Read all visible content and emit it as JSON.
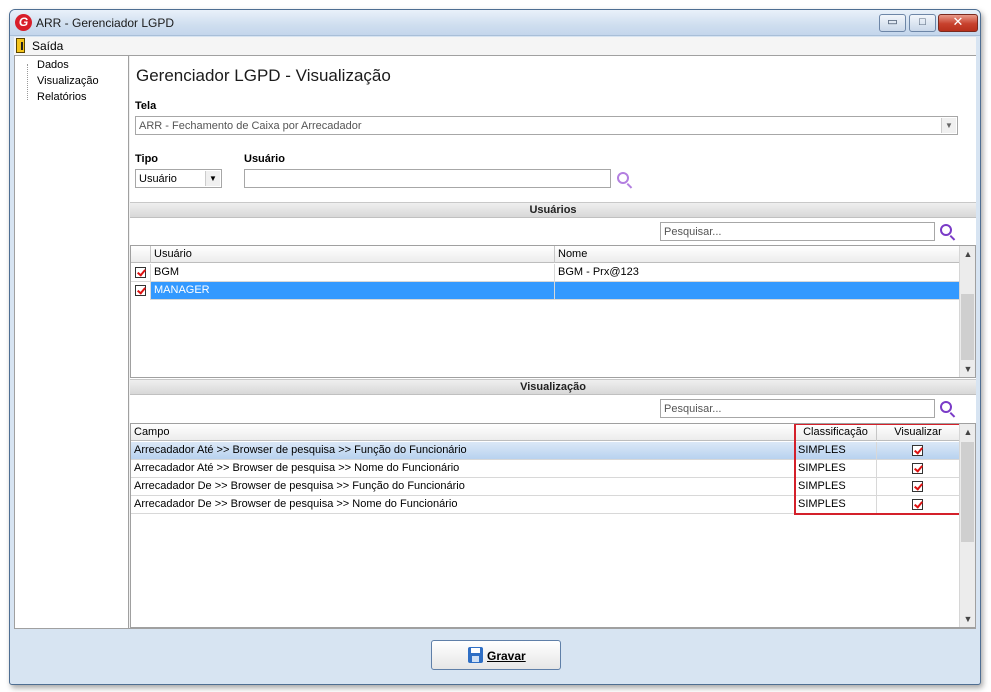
{
  "window": {
    "title": "ARR - Gerenciador LGPD",
    "app_icon_letter": "G",
    "controls": {
      "minimize": "▭",
      "maximize": "□",
      "close": "✕"
    }
  },
  "menu": {
    "exit_label": "Saída"
  },
  "tree": {
    "items": [
      "Dados",
      "Visualização",
      "Relatórios"
    ]
  },
  "page": {
    "title": "Gerenciador LGPD - Visualização",
    "tela_label": "Tela",
    "tela_value": "ARR - Fechamento de Caixa por Arrecadador",
    "tipo_label": "Tipo",
    "tipo_value": "Usuário",
    "usuario_label": "Usuário",
    "usuario_value": ""
  },
  "usuarios": {
    "section_title": "Usuários",
    "search_placeholder": "Pesquisar...",
    "columns": [
      "Usuário",
      "Nome"
    ],
    "rows": [
      {
        "checked": true,
        "usuario": "BGM",
        "nome": "BGM - Prx@123",
        "selected": false
      },
      {
        "checked": true,
        "usuario": "MANAGER",
        "nome": "",
        "selected": true
      }
    ]
  },
  "visualizacao": {
    "section_title": "Visualização",
    "search_placeholder": "Pesquisar...",
    "columns": [
      "Campo",
      "Classificação",
      "Visualizar"
    ],
    "rows": [
      {
        "campo": "Arrecadador Até >> Browser de pesquisa >> Função do Funcionário",
        "classificacao": "SIMPLES",
        "visualizar": true
      },
      {
        "campo": "Arrecadador Até >> Browser de pesquisa >> Nome do Funcionário",
        "classificacao": "SIMPLES",
        "visualizar": true
      },
      {
        "campo": "Arrecadador De >> Browser de pesquisa >> Função do Funcionário",
        "classificacao": "SIMPLES",
        "visualizar": true
      },
      {
        "campo": "Arrecadador De >> Browser de pesquisa >> Nome do Funcionário",
        "classificacao": "SIMPLES",
        "visualizar": true
      }
    ]
  },
  "footer": {
    "save_label": "Gravar"
  },
  "colors": {
    "selection": "#3399ff",
    "highlight_border": "#d4202a",
    "check_mark": "#dd1111",
    "search_icon": "#7a3bc7"
  }
}
